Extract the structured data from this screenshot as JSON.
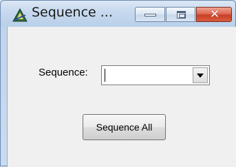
{
  "window": {
    "title": "Sequence ...",
    "close_glyph": "✕"
  },
  "icons": {
    "app": "app-triangle-icon",
    "minimize": "minimize-icon",
    "maximize": "maximize-icon",
    "close": "close-icon",
    "dropdown": "chevron-down-icon"
  },
  "form": {
    "sequence_label": "Sequence:",
    "sequence_value": "",
    "sequence_all_label": "Sequence All"
  },
  "colors": {
    "close_button": "#c83f26",
    "titlebar": "#c6d8ee",
    "client_background": "#f0f0f0"
  }
}
